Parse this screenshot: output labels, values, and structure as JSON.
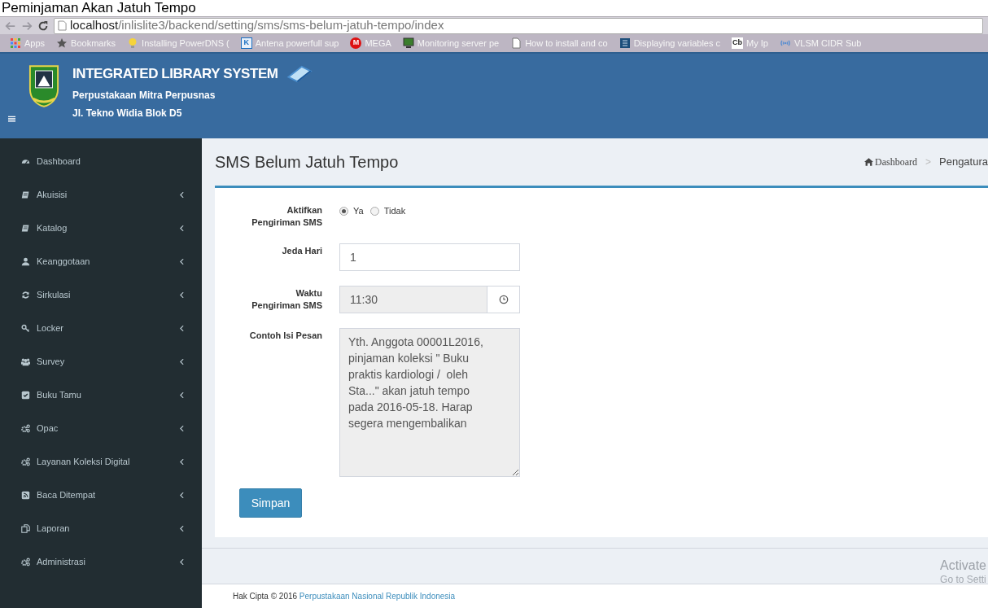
{
  "page_heading": "Peminjaman Akan Jatuh Tempo",
  "browser": {
    "url_host": "localhost",
    "url_path": "/inlislite3/backend/setting/sms/sms-belum-jatuh-tempo/index",
    "bookmarks": [
      {
        "kind": "apps",
        "label": "Apps"
      },
      {
        "kind": "star",
        "label": "Bookmarks"
      },
      {
        "kind": "bulb",
        "label": "Installing PowerDNS ("
      },
      {
        "kind": "badge",
        "badge": "K",
        "label": "Antena powerfull sup"
      },
      {
        "kind": "badge",
        "badge": "M",
        "label": "MEGA"
      },
      {
        "kind": "monitor",
        "label": "Monitoring server pe"
      },
      {
        "kind": "page",
        "label": "How to install and co"
      },
      {
        "kind": "grid",
        "label": "Displaying variables c"
      },
      {
        "kind": "badge",
        "badge": "Cb",
        "label": "My Ip"
      },
      {
        "kind": "signal",
        "label": "VLSM CIDR Sub"
      }
    ]
  },
  "header": {
    "title": "INTEGRATED LIBRARY SYSTEM",
    "subtitle": "Perpustakaan Mitra Perpusnas",
    "address": "Jl. Tekno Widia Blok D5"
  },
  "sidebar": {
    "items": [
      {
        "kind": "gauge",
        "label": "Dashboard",
        "has_caret": false
      },
      {
        "kind": "book",
        "label": "Akuisisi",
        "has_caret": true
      },
      {
        "kind": "book",
        "label": "Katalog",
        "has_caret": true
      },
      {
        "kind": "user",
        "label": "Keanggotaan",
        "has_caret": true
      },
      {
        "kind": "refresh",
        "label": "Sirkulasi",
        "has_caret": true
      },
      {
        "kind": "key",
        "label": "Locker",
        "has_caret": true
      },
      {
        "kind": "users",
        "label": "Survey",
        "has_caret": true
      },
      {
        "kind": "check",
        "label": "Buku Tamu",
        "has_caret": true
      },
      {
        "kind": "gears",
        "label": "Opac",
        "has_caret": true
      },
      {
        "kind": "gears",
        "label": "Layanan Koleksi Digital",
        "has_caret": true
      },
      {
        "kind": "rss",
        "label": "Baca Ditempat",
        "has_caret": true
      },
      {
        "kind": "copy",
        "label": "Laporan",
        "has_caret": true
      },
      {
        "kind": "gears",
        "label": "Administrasi",
        "has_caret": true
      }
    ]
  },
  "content": {
    "title": "SMS Belum Jatuh Tempo",
    "breadcrumb": [
      {
        "kind": "home",
        "label": "Dashboard"
      },
      {
        "kind": "plain",
        "label": "Pengatura"
      }
    ],
    "breadcrumb_separator": ">",
    "form": [
      {
        "kind": "radio",
        "label": "Aktifkan Pengiriman SMS",
        "options": [
          {
            "label": "Ya",
            "selected": true
          },
          {
            "label": "Tidak",
            "selected": false
          }
        ]
      },
      {
        "kind": "text",
        "label": "Jeda Hari",
        "value": "1"
      },
      {
        "kind": "time",
        "label": "Waktu Pengiriman SMS",
        "value": "11:30"
      },
      {
        "kind": "textarea",
        "label": "Contoh Isi Pesan",
        "value": "Yth. Anggota 00001L2016, pinjaman koleksi \" Buku praktis kardiologi /  oleh Sta...\" akan jatuh tempo pada 2016-05-18. Harap segera mengembalikan"
      }
    ],
    "save_button": "Simpan"
  },
  "footer": {
    "text": "Hak Cipta © 2016",
    "link": "Perpustakaan Nasional Republik Indonesia"
  },
  "os_notice": {
    "title": "Activate",
    "subtitle": "Go to Setti"
  }
}
